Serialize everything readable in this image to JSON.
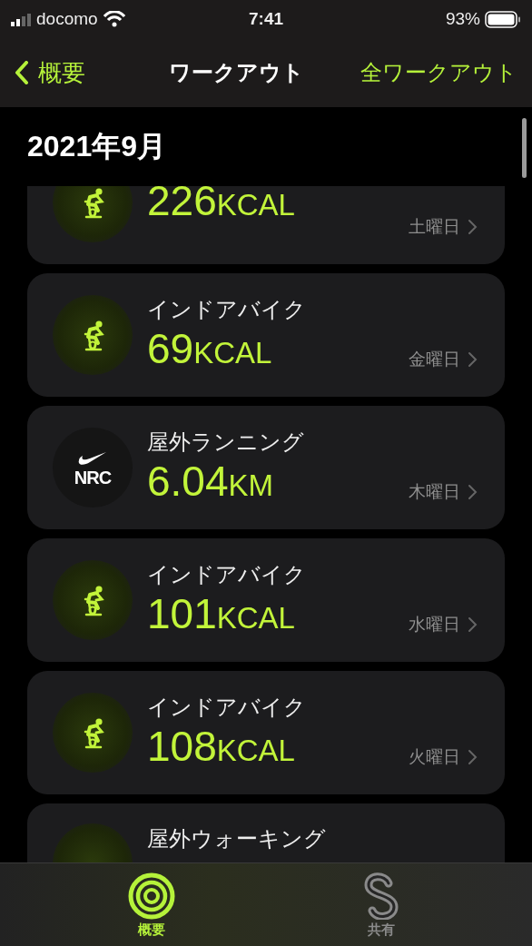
{
  "status_bar": {
    "carrier": "docomo",
    "time": "7:41",
    "battery": "93%"
  },
  "nav_bar": {
    "back": "概要",
    "title": "ワークアウト",
    "action": "全ワークアウト"
  },
  "section": {
    "title": "2021年9月"
  },
  "workouts": [
    {
      "kind": "bike",
      "value": "226",
      "unit": "KCAL",
      "day": "土曜日"
    },
    {
      "kind": "bike",
      "name": "インドアバイク",
      "value": "69",
      "unit": "KCAL",
      "day": "金曜日"
    },
    {
      "kind": "nrc",
      "logo_text": "NRC",
      "name": "屋外ランニング",
      "value": "6.04",
      "unit": "KM",
      "day": "木曜日"
    },
    {
      "kind": "bike",
      "name": "インドアバイク",
      "value": "101",
      "unit": "KCAL",
      "day": "水曜日"
    },
    {
      "kind": "bike",
      "name": "インドアバイク",
      "value": "108",
      "unit": "KCAL",
      "day": "火曜日"
    },
    {
      "kind": "walk",
      "name": "屋外ウォーキング"
    }
  ],
  "tab_bar": [
    {
      "kind": "rings",
      "label": "概要",
      "selected": true
    },
    {
      "kind": "share",
      "label": "共有",
      "selected": false
    }
  ]
}
